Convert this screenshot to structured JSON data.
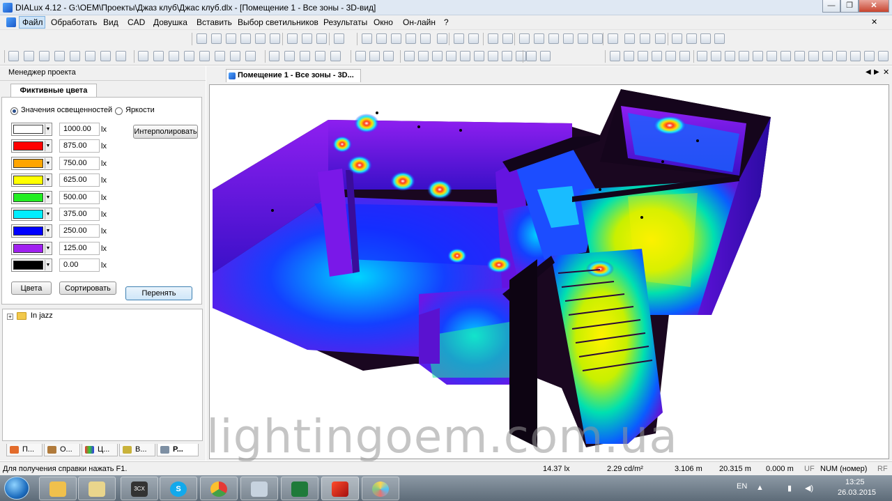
{
  "window": {
    "title": "DIALux 4.12 - G:\\OEM\\Проекты\\Джаз клуб\\Джас клуб.dlx - [Помещение 1 - Все зоны - 3D-вид]"
  },
  "menu": [
    "Файл",
    "Обработать",
    "Вид",
    "CAD",
    "Довушка",
    "Вставить",
    "Выбор светильников",
    "Результаты",
    "Окно",
    "Он-лайн",
    "?"
  ],
  "panel": {
    "header": "Менеджер проекта",
    "tab": "Фиктивные цвета",
    "radio_illuminance": "Значения освещенностей",
    "radio_brightness": "Яркости",
    "interpolate_button": "Интерполировать",
    "unit": "lx",
    "colors": [
      {
        "color": "#ffffff",
        "value": "1000.00"
      },
      {
        "color": "#ff0000",
        "value": "875.00"
      },
      {
        "color": "#ffa500",
        "value": "750.00"
      },
      {
        "color": "#ffff00",
        "value": "625.00"
      },
      {
        "color": "#22ee22",
        "value": "500.00"
      },
      {
        "color": "#00eeff",
        "value": "375.00"
      },
      {
        "color": "#0000ff",
        "value": "250.00"
      },
      {
        "color": "#a020f0",
        "value": "125.00"
      },
      {
        "color": "#000000",
        "value": "0.00"
      }
    ],
    "btn_colors": "Цвета",
    "btn_sort": "Сортировать",
    "btn_adopt": "Перенять",
    "tree_item": "In jazz",
    "bottom_tabs": [
      "П...",
      "О...",
      "Ц...",
      "В...",
      "Р..."
    ]
  },
  "document": {
    "tab": "Помещение 1 - Все зоны - 3D..."
  },
  "watermark": "lightingoem.com.ua",
  "status": {
    "help": "Для получения справки нажать F1.",
    "lux": "14.37 lx",
    "luminance": "2.29 cd/m²",
    "v1": "3.106 m",
    "v2": "20.315 m",
    "v3": "0.000 m",
    "uf": "UF",
    "num": "NUM (номер)",
    "rf": "RF"
  },
  "taskbar": {
    "lang": "EN",
    "time": "13:25",
    "date": "26.03.2015"
  },
  "icons": [
    "app-icon",
    "new-icon",
    "open-icon",
    "save-icon",
    "select-icon",
    "zoom-icon",
    "hand-icon",
    "folder-icon",
    "start-icon"
  ]
}
